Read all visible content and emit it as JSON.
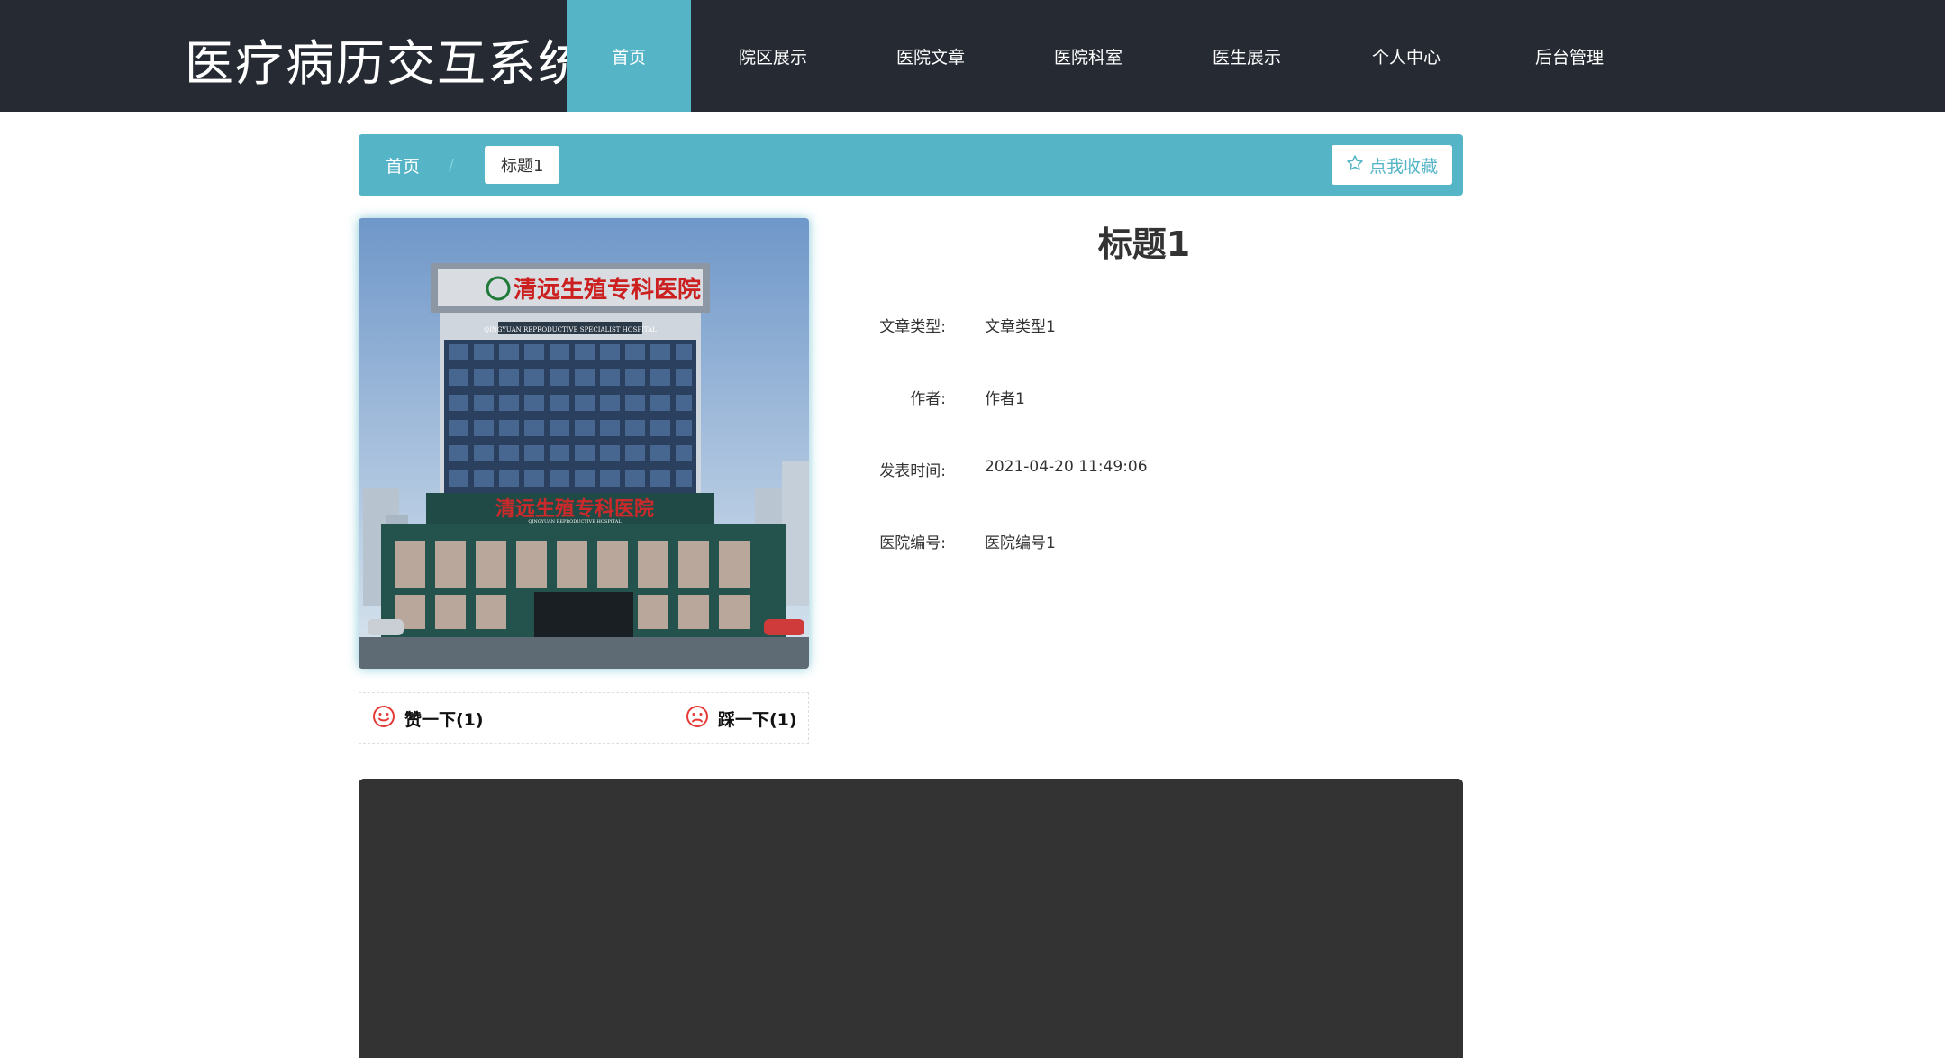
{
  "header": {
    "site_title": "医疗病历交互系统",
    "nav": [
      {
        "label": "首页",
        "active": true
      },
      {
        "label": "院区展示",
        "active": false
      },
      {
        "label": "医院文章",
        "active": false
      },
      {
        "label": "医院科室",
        "active": false
      },
      {
        "label": "医生展示",
        "active": false
      },
      {
        "label": "个人中心",
        "active": false
      },
      {
        "label": "后台管理",
        "active": false
      }
    ]
  },
  "breadcrumb": {
    "home": "首页",
    "separator": "/",
    "current": "标题1",
    "favorite_label": "点我收藏"
  },
  "image": {
    "sign_cn": "清远生殖专科医院",
    "sign_en": "QINGYUAN REPRODUCTIVE SPECIALIST HOSPITAL",
    "sign_en_small": "QINGYUAN REPRODUCTIVE HOSPITAL"
  },
  "votes": {
    "like_label": "赞一下(1)",
    "dislike_label": "踩一下(1)"
  },
  "detail": {
    "title": "标题1",
    "fields": [
      {
        "label": "文章类型:",
        "value": "文章类型1"
      },
      {
        "label": "作者:",
        "value": "作者1"
      },
      {
        "label": "发表时间:",
        "value": "2021-04-20 11:49:06"
      },
      {
        "label": "医院编号:",
        "value": "医院编号1"
      }
    ]
  },
  "colors": {
    "header_bg": "#262b33",
    "accent": "#55b5c7",
    "content_bg": "#333333",
    "vote_icon": "#e53935"
  }
}
